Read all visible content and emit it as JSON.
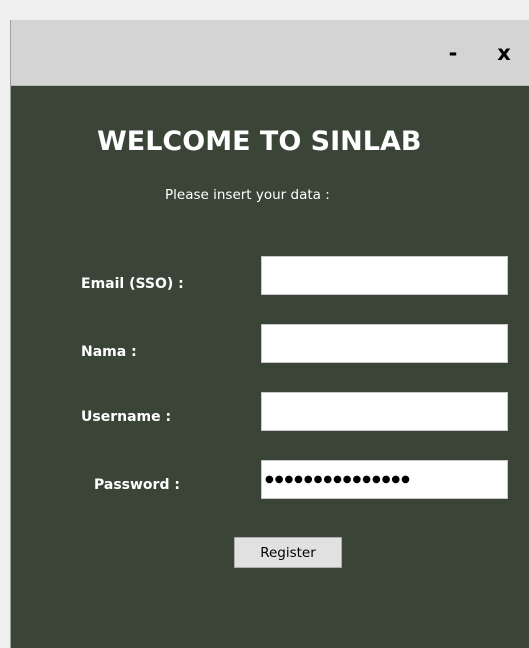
{
  "window": {
    "minimize_label": "-",
    "close_label": "x"
  },
  "form": {
    "title": "WELCOME TO SINLAB",
    "subtitle": "Please insert your data :",
    "email_label": "Email (SSO) :",
    "email_value": "",
    "nama_label": "Nama :",
    "nama_value": "",
    "username_label": "Username :",
    "username_value": "",
    "password_label": "Password :",
    "password_masked": "●●●●●●●●●●●●●●●",
    "register_label": "Register"
  },
  "colors": {
    "background": "#3a4538",
    "titlebar": "#d4d4d4",
    "text": "#ffffff"
  }
}
